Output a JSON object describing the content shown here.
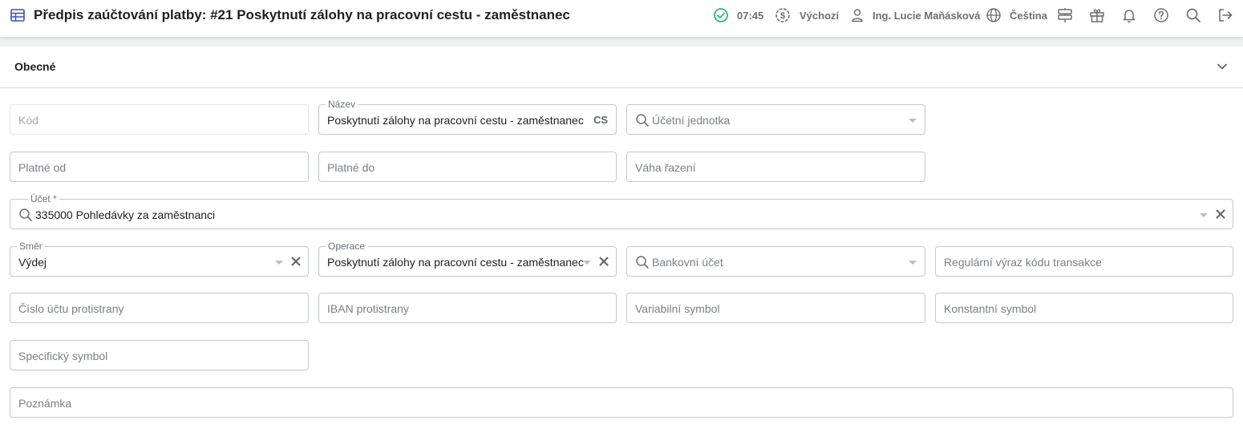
{
  "header": {
    "title": "Předpis zaúčtování platby: #21 Poskytnutí zálohy na pracovní cestu - zaměstnanec",
    "time": "07:45",
    "currency_profile": "Výchozí",
    "user": "Ing. Lucie Maňásková",
    "language": "Čeština"
  },
  "section": {
    "title": "Obecné"
  },
  "form": {
    "kod": {
      "placeholder": "Kód"
    },
    "nazev": {
      "label": "Název",
      "value": "Poskytnutí zálohy na pracovní cestu - zaměstnanec",
      "suffix": "CS"
    },
    "ucetni_jednotka": {
      "placeholder": "Účetní jednotka"
    },
    "platne_od": {
      "placeholder": "Platné od"
    },
    "platne_do": {
      "placeholder": "Platné do"
    },
    "vaha_razeni": {
      "placeholder": "Váha řazení"
    },
    "ucet": {
      "label": "Účet",
      "required": "*",
      "value": "335000 Pohledávky za zaměstnanci"
    },
    "smer": {
      "label": "Směr",
      "value": "Výdej"
    },
    "operace": {
      "label": "Operace",
      "value": "Poskytnutí zálohy na pracovní cestu - zaměstnanec"
    },
    "bankovni_ucet": {
      "placeholder": "Bankovní účet"
    },
    "regularni_vyraz": {
      "placeholder": "Regulární výraz kódu transakce"
    },
    "cislo_uctu_protistrany": {
      "placeholder": "Číslo účtu protistrany"
    },
    "iban_protistrany": {
      "placeholder": "IBAN protistrany"
    },
    "variabilni_symbol": {
      "placeholder": "Variabilní symbol"
    },
    "konstantni_symbol": {
      "placeholder": "Konstantní symbol"
    },
    "specificky_symbol": {
      "placeholder": "Specifický symbol"
    },
    "poznamka": {
      "placeholder": "Poznámka"
    }
  },
  "colors": {
    "accent": "#3f51b5",
    "status_ok": "#2eb872",
    "border": "#c4c8cd",
    "required": "#e5484d"
  },
  "icons": [
    "table-icon",
    "check-circle-icon",
    "dollar-circle-icon",
    "user-icon",
    "globe-icon",
    "signpost-icon",
    "gift-icon",
    "bell-icon",
    "help-icon",
    "search-icon",
    "logout-icon",
    "chevron-down-icon",
    "clear-icon"
  ]
}
